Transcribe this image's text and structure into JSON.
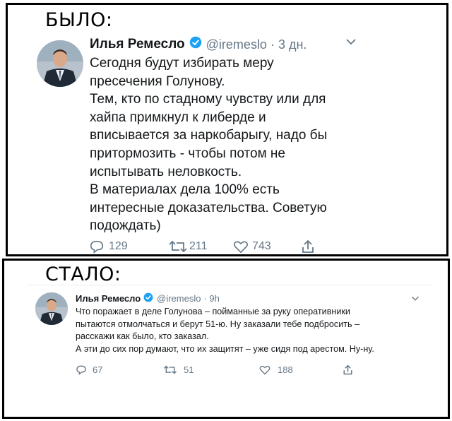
{
  "captions": {
    "before": "БЫЛО:",
    "after": "СТАЛО:"
  },
  "colors": {
    "verified": "#1da1f2",
    "text": "#14171a",
    "muted": "#657786"
  },
  "tweet_before": {
    "author": "Илья Ремесло",
    "handle": "@iremeslo",
    "time": "· 3 дн.",
    "menu_icon": "chevron-down-icon",
    "lines": [
      "Сегодня будут избирать меру",
      "пресечения Голунову.",
      "Тем, кто по стадному чувству или для",
      "хайпа примкнул к либерде и",
      "вписывается за наркобарыгу, надо бы",
      "притормозить - чтобы потом не",
      "испытывать неловкость.",
      "В материалах дела 100% есть",
      "интересные доказательства. Советую",
      "подождать)"
    ],
    "replies": "129",
    "retweets": "211",
    "likes": "743"
  },
  "tweet_after": {
    "author": "Илья Ремесло",
    "handle": "@iremeslo",
    "time": "· 9h",
    "menu_icon": "chevron-down-icon",
    "lines": [
      "Что поражает в деле Голунова –  пойманные за руку оперативники",
      "пытаются отмолчаться и берут 51-ю. Ну заказали тебе подбросить –",
      "расскажи как было, кто заказал.",
      "А эти до сих пор думают, что их защитят – уже сидя под арестом. Ну-ну."
    ],
    "replies": "67",
    "retweets": "51",
    "likes": "188"
  }
}
